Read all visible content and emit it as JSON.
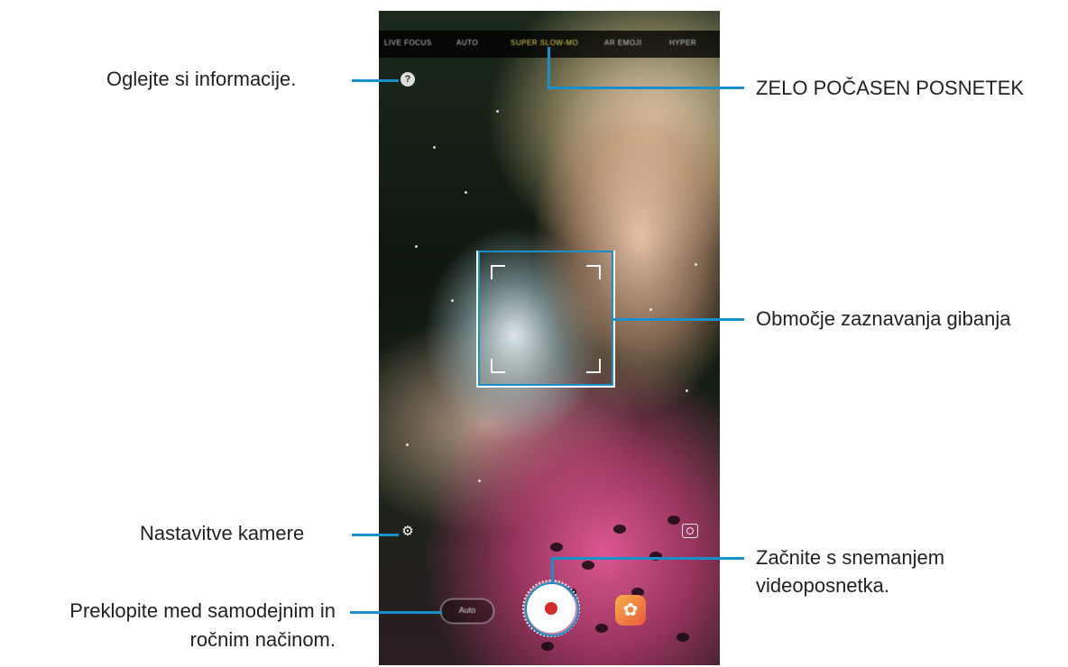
{
  "camera": {
    "modes": [
      "LIVE FOCUS",
      "AUTO",
      "SUPER SLOW-MO",
      "AR EMOJI",
      "HYPER"
    ],
    "active_mode": "SUPER SLOW-MO",
    "help_icon_glyph": "?",
    "settings_icon_glyph": "⚙",
    "auto_button_label": "Auto",
    "effects_icon_glyph": "✿"
  },
  "callouts": {
    "info": "Oglejte si informacije.",
    "super_slow": "ZELO POČASEN POSNETEK",
    "motion_area": "Območje zaznavanja gibanja",
    "settings": "Nastavitve kamere",
    "record_line1": "Začnite s snemanjem",
    "record_line2": "videoposnetka.",
    "switch_line1": "Preklopite med samodejnim in",
    "switch_line2": "ročnim načinom."
  },
  "colors": {
    "callout_line": "#1a8fc9",
    "active_mode": "#e7d45a",
    "record_dot": "#d42a2a"
  }
}
